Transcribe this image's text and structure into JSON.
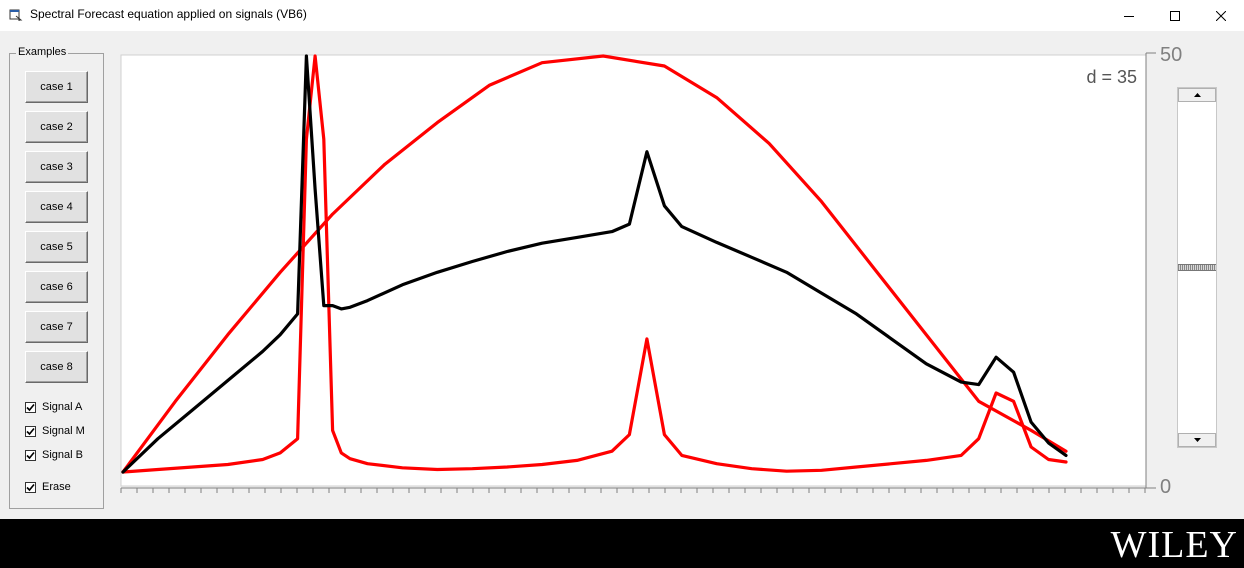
{
  "window": {
    "title": "Spectral Forecast equation applied on signals (VB6)",
    "controls": [
      "minimize-icon",
      "maximize-icon",
      "close-icon"
    ]
  },
  "examples": {
    "group_label": "Examples",
    "buttons": [
      "case 1",
      "case 2",
      "case 3",
      "case 4",
      "case 5",
      "case 6",
      "case 7",
      "case 8"
    ],
    "checkboxes": [
      {
        "label": "Signal A",
        "checked": true
      },
      {
        "label": "Signal M",
        "checked": true
      },
      {
        "label": "Signal B",
        "checked": true
      },
      {
        "label": "Erase",
        "checked": true
      }
    ]
  },
  "plot": {
    "annotation": "d = 35",
    "ylabel_top": "50",
    "ylabel_bottom": "0"
  },
  "slider": {
    "position_fraction": 0.5
  },
  "footer": {
    "brand": "WILEY"
  },
  "colors": {
    "signal_a": "#ff0000",
    "signal_b": "#ff0000",
    "signal_m": "#000000",
    "axis": "#808080",
    "footer_bg": "#000000"
  },
  "chart_data": {
    "type": "line",
    "ylim": [
      0,
      50
    ],
    "xlim": [
      0,
      55
    ],
    "y_tick_labels": [
      "0",
      "50"
    ],
    "annotation": "d = 35",
    "series": [
      {
        "name": "Signal A",
        "color": "#ff0000",
        "x": [
          0,
          2,
          4,
          6,
          8,
          9,
          10,
          10.5,
          11,
          11.5,
          12,
          12.5,
          13,
          14,
          16,
          18,
          20,
          22,
          24,
          26,
          28,
          29,
          30,
          31,
          32,
          34,
          36,
          38,
          40,
          42,
          44,
          46,
          48,
          49,
          50,
          51,
          52,
          53,
          54
        ],
        "y": [
          0,
          0.3,
          0.6,
          0.9,
          1.5,
          2.3,
          4.0,
          40.0,
          50.0,
          40.0,
          5.0,
          2.3,
          1.6,
          1.0,
          0.5,
          0.3,
          0.4,
          0.6,
          0.9,
          1.4,
          2.5,
          4.5,
          16.0,
          4.5,
          2.0,
          1.0,
          0.4,
          0.1,
          0.2,
          0.6,
          1.0,
          1.4,
          2.0,
          4.0,
          9.5,
          8.5,
          3.0,
          1.5,
          1.2
        ]
      },
      {
        "name": "Signal M",
        "color": "#000000",
        "x": [
          0,
          2,
          4,
          6,
          8,
          9,
          10,
          10.5,
          11,
          11.5,
          12,
          12.5,
          13,
          14,
          16,
          18,
          20,
          22,
          24,
          26,
          28,
          29,
          30,
          31,
          32,
          34,
          36,
          38,
          40,
          42,
          44,
          46,
          48,
          49,
          50,
          51,
          52,
          53,
          54
        ],
        "y": [
          0,
          4.0,
          7.5,
          11.0,
          14.5,
          16.5,
          19.0,
          50.0,
          34.0,
          20.0,
          20.0,
          19.6,
          19.8,
          20.6,
          22.5,
          24.0,
          25.3,
          26.5,
          27.5,
          28.2,
          28.9,
          29.8,
          38.5,
          32.0,
          29.5,
          27.6,
          25.8,
          24.0,
          21.5,
          19.0,
          16.0,
          13.0,
          10.8,
          10.5,
          13.8,
          12.0,
          6.0,
          3.5,
          2.0
        ]
      },
      {
        "name": "Signal B",
        "color": "#ff0000",
        "x": [
          0,
          3,
          6,
          9,
          12,
          15,
          18,
          21,
          24,
          27.5,
          31,
          34,
          37,
          40,
          43,
          46,
          49,
          52,
          54
        ],
        "y": [
          0,
          8.5,
          16.5,
          24.0,
          31.0,
          37.0,
          42.0,
          46.5,
          49.2,
          50.0,
          48.8,
          45.0,
          39.5,
          32.5,
          24.5,
          16.5,
          8.5,
          5.0,
          2.5
        ]
      }
    ]
  }
}
